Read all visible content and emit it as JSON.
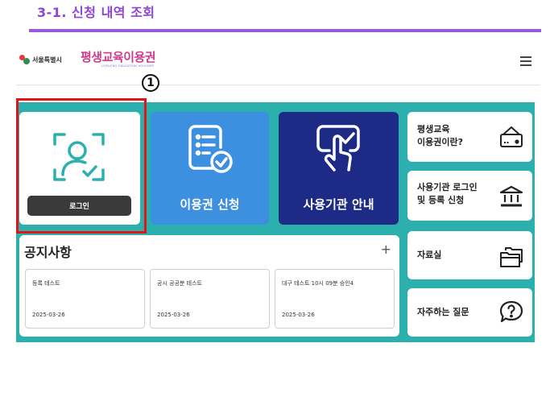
{
  "step": {
    "title": "3-1. 신청 내역 조회"
  },
  "header": {
    "seoul_logo_text": "서울특별시",
    "brand_logo_text": "평생교육이용권",
    "brand_logo_sub": "LIFELONG EDUCATION VOUCHER"
  },
  "marker": {
    "label": "1"
  },
  "login": {
    "button_label": "로그인"
  },
  "tiles": {
    "apply_label": "이용권 신청",
    "guide_label": "사용기관 안내"
  },
  "side": {
    "about_line1": "평생교육",
    "about_line2": "이용권이란?",
    "org_line1": "사용기관 로그인",
    "org_line2": "및 등록 신청",
    "resources_label": "자료실",
    "faq_label": "자주하는 질문"
  },
  "notice": {
    "title": "공지사항",
    "plus": "+",
    "items": [
      {
        "title": "등록 테스트",
        "date": "2025-03-26"
      },
      {
        "title": "공시 공공분 테스트",
        "date": "2025-03-26"
      },
      {
        "title": "대구 테스트 10시 09분 승인4",
        "date": "2025-03-26"
      }
    ]
  },
  "colors": {
    "accent_purple": "#9b59e0",
    "teal_panel": "#2bb0ae",
    "apply_blue": "#3d8fe0",
    "guide_navy": "#1d2b86",
    "highlight_red": "#e01515"
  }
}
